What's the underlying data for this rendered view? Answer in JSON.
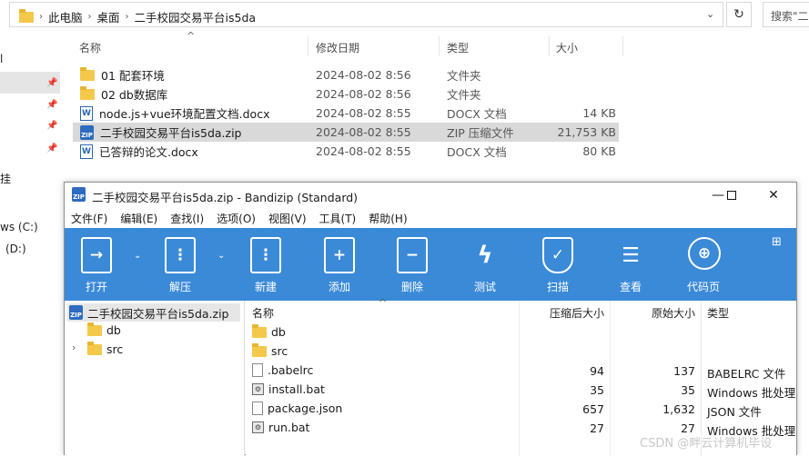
{
  "explorer": {
    "breadcrumb": [
      "此电脑",
      "桌面",
      "二手校园交易平台is5da"
    ],
    "search_placeholder": "搜索\"二",
    "columns": {
      "name": "名称",
      "date": "修改日期",
      "type": "类型",
      "size": "大小"
    },
    "files": [
      {
        "name": "01  配套环境",
        "date": "2024-08-02 8:56",
        "type": "文件夹",
        "size": "",
        "icon": "folder"
      },
      {
        "name": "02 db数据库",
        "date": "2024-08-02 8:56",
        "type": "文件夹",
        "size": "",
        "icon": "folder"
      },
      {
        "name": "node.js+vue环境配置文档.docx",
        "date": "2024-08-02 8:55",
        "type": "DOCX 文档",
        "size": "14 KB",
        "icon": "docx"
      },
      {
        "name": "二手校园交易平台is5da.zip",
        "date": "2024-08-02 8:55",
        "type": "ZIP 压缩文件",
        "size": "21,753 KB",
        "icon": "zip"
      },
      {
        "name": "已答辩的论文.docx",
        "date": "2024-08-02 8:55",
        "type": "DOCX 文档",
        "size": "80 KB",
        "icon": "docx"
      }
    ],
    "nav": {
      "item_a": "ws (C:)",
      "item_b": "(D:)",
      "frag1": "l",
      "frag2": "挂"
    }
  },
  "bandizip": {
    "title": "二手校园交易平台is5da.zip - Bandizip (Standard)",
    "menu": [
      "文件(F)",
      "编辑(E)",
      "查找(I)",
      "选项(O)",
      "视图(V)",
      "工具(T)",
      "帮助(H)"
    ],
    "toolbar": [
      {
        "label": "打开",
        "icon": "open-icon"
      },
      {
        "label": "解压",
        "icon": "extract-icon"
      },
      {
        "label": "新建",
        "icon": "new-archive-icon"
      },
      {
        "label": "添加",
        "icon": "add-icon"
      },
      {
        "label": "删除",
        "icon": "delete-icon"
      },
      {
        "label": "测试",
        "icon": "test-icon"
      },
      {
        "label": "扫描",
        "icon": "scan-icon"
      },
      {
        "label": "查看",
        "icon": "view-icon"
      },
      {
        "label": "代码页",
        "icon": "codepage-icon"
      }
    ],
    "tree": {
      "root": "二手校园交易平台is5da.zip",
      "children": [
        "db",
        "src"
      ]
    },
    "list_columns": {
      "name": "名称",
      "compressed": "压缩后大小",
      "original": "原始大小",
      "type": "类型"
    },
    "list": [
      {
        "name": "db",
        "compressed": "",
        "original": "",
        "type": "",
        "icon": "folder"
      },
      {
        "name": "src",
        "compressed": "",
        "original": "",
        "type": "",
        "icon": "folder"
      },
      {
        "name": ".babelrc",
        "compressed": "94",
        "original": "137",
        "type": "BABELRC 文件",
        "icon": "file"
      },
      {
        "name": "install.bat",
        "compressed": "35",
        "original": "35",
        "type": "Windows 批处理",
        "icon": "bat"
      },
      {
        "name": "package.json",
        "compressed": "657",
        "original": "1,632",
        "type": "JSON 文件",
        "icon": "file"
      },
      {
        "name": "run.bat",
        "compressed": "27",
        "original": "27",
        "type": "Windows 批处理",
        "icon": "bat"
      }
    ]
  },
  "watermark": "CSDN @畔云计算机毕设",
  "colors": {
    "toolbar_blue": "#3a8ad8",
    "selected_row": "#d9d9d9",
    "folder": "#f4c84a"
  }
}
